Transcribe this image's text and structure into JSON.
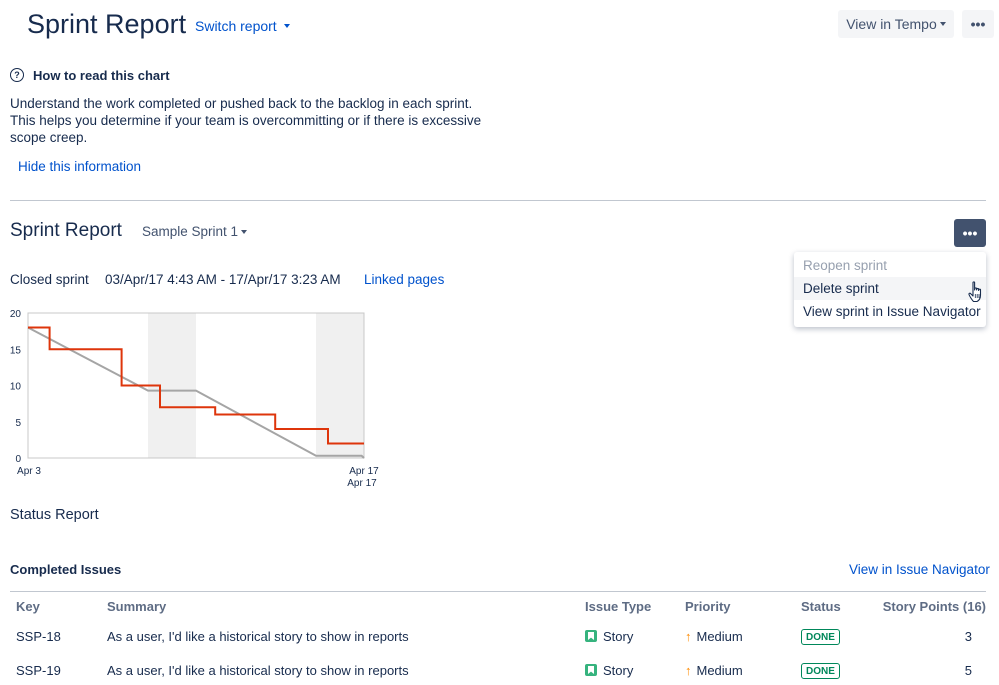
{
  "header": {
    "title": "Sprint Report",
    "switch_report": "Switch report",
    "view_in_tempo": "View in Tempo",
    "more": "•••"
  },
  "info": {
    "heading": "How to read this chart",
    "text": "Understand the work completed or pushed back to the backlog in each sprint. This helps you determine if your team is overcommitting or if there is excessive scope creep.",
    "hide": "Hide this information"
  },
  "sprint": {
    "title": "Sprint Report",
    "selected_sprint": "Sample Sprint 1",
    "more": "•••",
    "status": "Closed sprint",
    "dates": "03/Apr/17 4:43 AM - 17/Apr/17 3:23 AM",
    "linked_pages": "Linked pages",
    "menu": [
      {
        "label": "Reopen sprint",
        "state": "disabled"
      },
      {
        "label": "Delete sprint",
        "state": "hover"
      },
      {
        "label": "View sprint in Issue Navigator",
        "state": "normal"
      }
    ]
  },
  "chart_data": {
    "type": "line",
    "title": "",
    "xlabel": "",
    "ylabel": "",
    "x_tick_labels": [
      "Apr 3",
      "Apr 17",
      "Apr 17"
    ],
    "y_ticks": [
      0,
      5,
      10,
      15,
      20
    ],
    "ylim": [
      0,
      20
    ],
    "xlim_days": [
      3,
      17
    ],
    "non_working_periods": [
      [
        8,
        10
      ],
      [
        15,
        17
      ]
    ],
    "series": [
      {
        "color": "#de350b",
        "step": true,
        "points": [
          [
            3,
            18
          ],
          [
            3.9,
            18
          ],
          [
            3.9,
            15
          ],
          [
            6.9,
            15
          ],
          [
            6.9,
            10
          ],
          [
            8.5,
            10
          ],
          [
            8.5,
            7
          ],
          [
            10.8,
            7
          ],
          [
            10.8,
            6
          ],
          [
            13.3,
            6
          ],
          [
            13.3,
            4
          ],
          [
            15.5,
            4
          ],
          [
            15.5,
            2
          ],
          [
            17,
            2
          ]
        ]
      },
      {
        "color": "#a5a5a5",
        "step": false,
        "points": [
          [
            3,
            18
          ],
          [
            8,
            9.3
          ],
          [
            10,
            9.3
          ],
          [
            15,
            0.3
          ],
          [
            16.9,
            0.3
          ],
          [
            17,
            0
          ]
        ]
      }
    ]
  },
  "status_report": {
    "title": "Status Report",
    "completed_title": "Completed Issues",
    "view_navigator": "View in Issue Navigator",
    "columns": [
      "Key",
      "Summary",
      "Issue Type",
      "Priority",
      "Status",
      "Story Points (16)"
    ],
    "rows": [
      {
        "key": "SSP-18",
        "summary": "As a user, I'd like a historical story to show in reports",
        "type": "Story",
        "priority": "Medium",
        "status": "DONE",
        "points": "3"
      },
      {
        "key": "SSP-19",
        "summary": "As a user, I'd like a historical story to show in reports",
        "type": "Story",
        "priority": "Medium",
        "status": "DONE",
        "points": "5"
      }
    ]
  }
}
